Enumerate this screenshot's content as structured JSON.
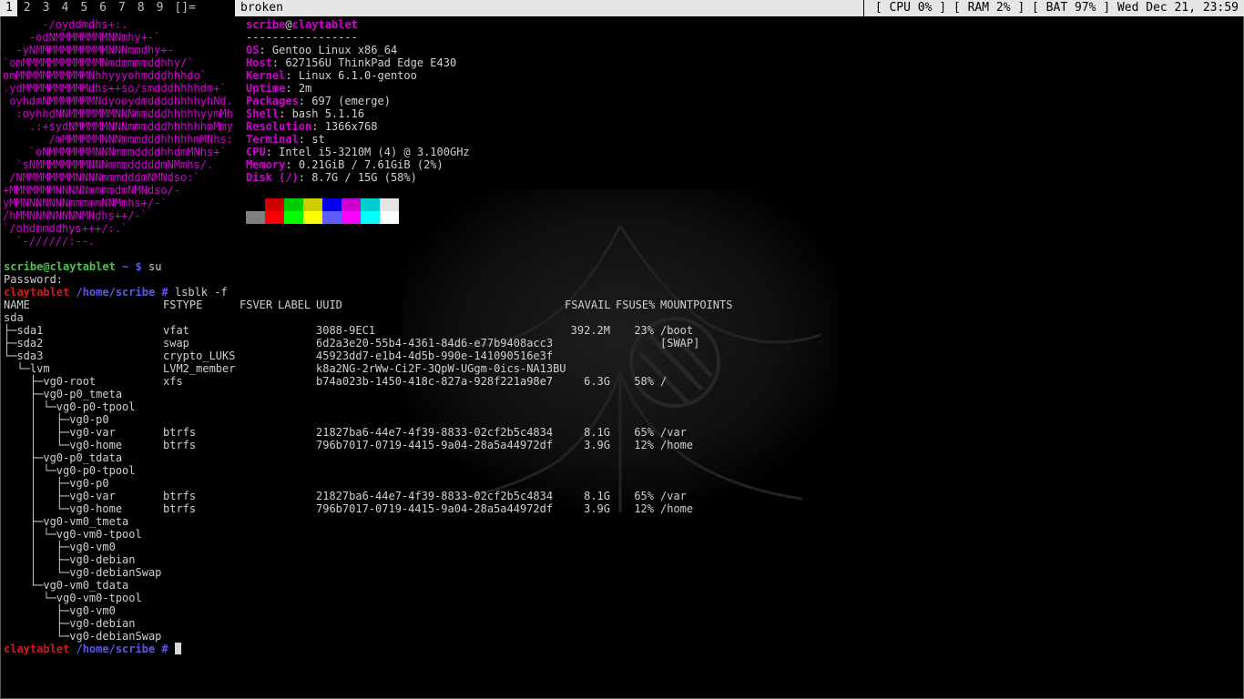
{
  "bar": {
    "tags": [
      "1",
      "2",
      "3",
      "4",
      "5",
      "6",
      "7",
      "8",
      "9"
    ],
    "active_tag": 0,
    "layout": "[]=",
    "window_title": "broken",
    "status": "[ CPU 0% ] [ RAM 2% ] [ BAT 97% ] Wed Dec 21, 23:59"
  },
  "neofetch": {
    "logo": [
      "      -/oyddmdhs+:.",
      "    -odNMMMMMMMMNNmhy+-`",
      "  -yNMMMMMMMMMMMNNNmmdhy+-",
      "`omMMMMMMMMMMMMNmdmmmmddhhy/`",
      "omMMMMMMMMMMMNhhyyyohmdddhhhdo`",
      ".ydMMMMMMMMMMdhs++so/smdddhhhhdm+`",
      " oyhdmNMMMMMMMNdyooydmddddhhhhyhNd.",
      "  :oyhhdNNMMMMMMMNNNmmdddhhhhhyymMh",
      "    .:+sydNMMMMMNNNmmmdddhhhhhhmMmy",
      "       /mMMMMMMNNNmmmdddhhhhhmMNhs:",
      "    `oNMMMMMMMNNNmmmddddhhdmMNhs+`",
      "  `sNMMMMMMMMNNNmmmdddddmNMmhs/.",
      " /NMMMMMMMMNNNNmmmdddmNMNdso:`",
      "+MMMMMMMNNNNNmmmmdmNMNdso/-",
      "yMMNNNNNNNmmmmmNNMmhs+/-`",
      "/hMMNNNNNNNNMNdhs++/-`",
      "`/ohdmmddhys+++/:.`",
      "  `-//////:--."
    ],
    "user": "scribe",
    "host": "claytablet",
    "separator": "-----------------",
    "info": [
      {
        "key": "OS",
        "value": "Gentoo Linux x86_64"
      },
      {
        "key": "Host",
        "value": "627156U ThinkPad Edge E430"
      },
      {
        "key": "Kernel",
        "value": "Linux 6.1.0-gentoo"
      },
      {
        "key": "Uptime",
        "value": "2m"
      },
      {
        "key": "Packages",
        "value": "697 (emerge)"
      },
      {
        "key": "Shell",
        "value": "bash 5.1.16"
      },
      {
        "key": "Resolution",
        "value": "1366x768"
      },
      {
        "key": "Terminal",
        "value": "st"
      },
      {
        "key": "CPU",
        "value": "Intel i5-3210M (4) @ 3.100GHz"
      },
      {
        "key": "Memory",
        "value": "0.21GiB / 7.61GiB (2%)"
      },
      {
        "key": "Disk (/)",
        "value": "8.7G / 15G (58%)"
      }
    ],
    "palette_top": [
      "#000000",
      "#cd0000",
      "#00cd00",
      "#cdcd00",
      "#0000ee",
      "#cd00cd",
      "#00cdcd",
      "#e5e5e5"
    ],
    "palette_bottom": [
      "#7f7f7f",
      "#ff0000",
      "#00ff00",
      "#ffff00",
      "#5c5cff",
      "#ff00ff",
      "#00ffff",
      "#ffffff"
    ]
  },
  "shell": {
    "prompt1": {
      "user": "scribe@claytablet",
      "path": "~",
      "sym": "$",
      "cmd": "su"
    },
    "password_line": "Password:",
    "prompt2": {
      "host": "claytablet",
      "path": "/home/scribe",
      "sym": "#",
      "cmd": "lsblk -f"
    },
    "prompt3": {
      "host": "claytablet",
      "path": "/home/scribe",
      "sym": "#"
    }
  },
  "lsblk": {
    "headers": {
      "name": "NAME",
      "fstype": "FSTYPE",
      "fsver": "FSVER",
      "label": "LABEL",
      "uuid": "UUID",
      "avail": "FSAVAIL",
      "use": "FSUSE%",
      "mount": "MOUNTPOINTS"
    },
    "rows": [
      {
        "name": "sda",
        "fstype": "",
        "uuid": "",
        "avail": "",
        "use": "",
        "mount": ""
      },
      {
        "name": "├─sda1",
        "fstype": "vfat",
        "uuid": "3088-9EC1",
        "avail": "392.2M",
        "use": "23%",
        "mount": "/boot"
      },
      {
        "name": "├─sda2",
        "fstype": "swap",
        "uuid": "6d2a3e20-55b4-4361-84d6-e77b9408acc3",
        "avail": "",
        "use": "",
        "mount": "[SWAP]"
      },
      {
        "name": "└─sda3",
        "fstype": "crypto_LUKS",
        "uuid": "45923dd7-e1b4-4d5b-990e-141090516e3f",
        "avail": "",
        "use": "",
        "mount": ""
      },
      {
        "name": "  └─lvm",
        "fstype": "LVM2_member",
        "uuid": "k8a2NG-2rWw-Ci2F-3QpW-UGgm-0ics-NA13BU",
        "avail": "",
        "use": "",
        "mount": ""
      },
      {
        "name": "    ├─vg0-root",
        "fstype": "xfs",
        "uuid": "b74a023b-1450-418c-827a-928f221a98e7",
        "avail": "6.3G",
        "use": "58%",
        "mount": "/"
      },
      {
        "name": "    ├─vg0-p0_tmeta",
        "fstype": "",
        "uuid": "",
        "avail": "",
        "use": "",
        "mount": ""
      },
      {
        "name": "    │ └─vg0-p0-tpool",
        "fstype": "",
        "uuid": "",
        "avail": "",
        "use": "",
        "mount": ""
      },
      {
        "name": "    │   ├─vg0-p0",
        "fstype": "",
        "uuid": "",
        "avail": "",
        "use": "",
        "mount": ""
      },
      {
        "name": "    │   ├─vg0-var",
        "fstype": "btrfs",
        "uuid": "21827ba6-44e7-4f39-8833-02cf2b5c4834",
        "avail": "8.1G",
        "use": "65%",
        "mount": "/var"
      },
      {
        "name": "    │   └─vg0-home",
        "fstype": "btrfs",
        "uuid": "796b7017-0719-4415-9a04-28a5a44972df",
        "avail": "3.9G",
        "use": "12%",
        "mount": "/home"
      },
      {
        "name": "    ├─vg0-p0_tdata",
        "fstype": "",
        "uuid": "",
        "avail": "",
        "use": "",
        "mount": ""
      },
      {
        "name": "    │ └─vg0-p0-tpool",
        "fstype": "",
        "uuid": "",
        "avail": "",
        "use": "",
        "mount": ""
      },
      {
        "name": "    │   ├─vg0-p0",
        "fstype": "",
        "uuid": "",
        "avail": "",
        "use": "",
        "mount": ""
      },
      {
        "name": "    │   ├─vg0-var",
        "fstype": "btrfs",
        "uuid": "21827ba6-44e7-4f39-8833-02cf2b5c4834",
        "avail": "8.1G",
        "use": "65%",
        "mount": "/var"
      },
      {
        "name": "    │   └─vg0-home",
        "fstype": "btrfs",
        "uuid": "796b7017-0719-4415-9a04-28a5a44972df",
        "avail": "3.9G",
        "use": "12%",
        "mount": "/home"
      },
      {
        "name": "    ├─vg0-vm0_tmeta",
        "fstype": "",
        "uuid": "",
        "avail": "",
        "use": "",
        "mount": ""
      },
      {
        "name": "    │ └─vg0-vm0-tpool",
        "fstype": "",
        "uuid": "",
        "avail": "",
        "use": "",
        "mount": ""
      },
      {
        "name": "    │   ├─vg0-vm0",
        "fstype": "",
        "uuid": "",
        "avail": "",
        "use": "",
        "mount": ""
      },
      {
        "name": "    │   ├─vg0-debian",
        "fstype": "",
        "uuid": "",
        "avail": "",
        "use": "",
        "mount": ""
      },
      {
        "name": "    │   └─vg0-debianSwap",
        "fstype": "",
        "uuid": "",
        "avail": "",
        "use": "",
        "mount": ""
      },
      {
        "name": "    └─vg0-vm0_tdata",
        "fstype": "",
        "uuid": "",
        "avail": "",
        "use": "",
        "mount": ""
      },
      {
        "name": "      └─vg0-vm0-tpool",
        "fstype": "",
        "uuid": "",
        "avail": "",
        "use": "",
        "mount": ""
      },
      {
        "name": "        ├─vg0-vm0",
        "fstype": "",
        "uuid": "",
        "avail": "",
        "use": "",
        "mount": ""
      },
      {
        "name": "        ├─vg0-debian",
        "fstype": "",
        "uuid": "",
        "avail": "",
        "use": "",
        "mount": ""
      },
      {
        "name": "        └─vg0-debianSwap",
        "fstype": "",
        "uuid": "",
        "avail": "",
        "use": "",
        "mount": ""
      }
    ]
  }
}
